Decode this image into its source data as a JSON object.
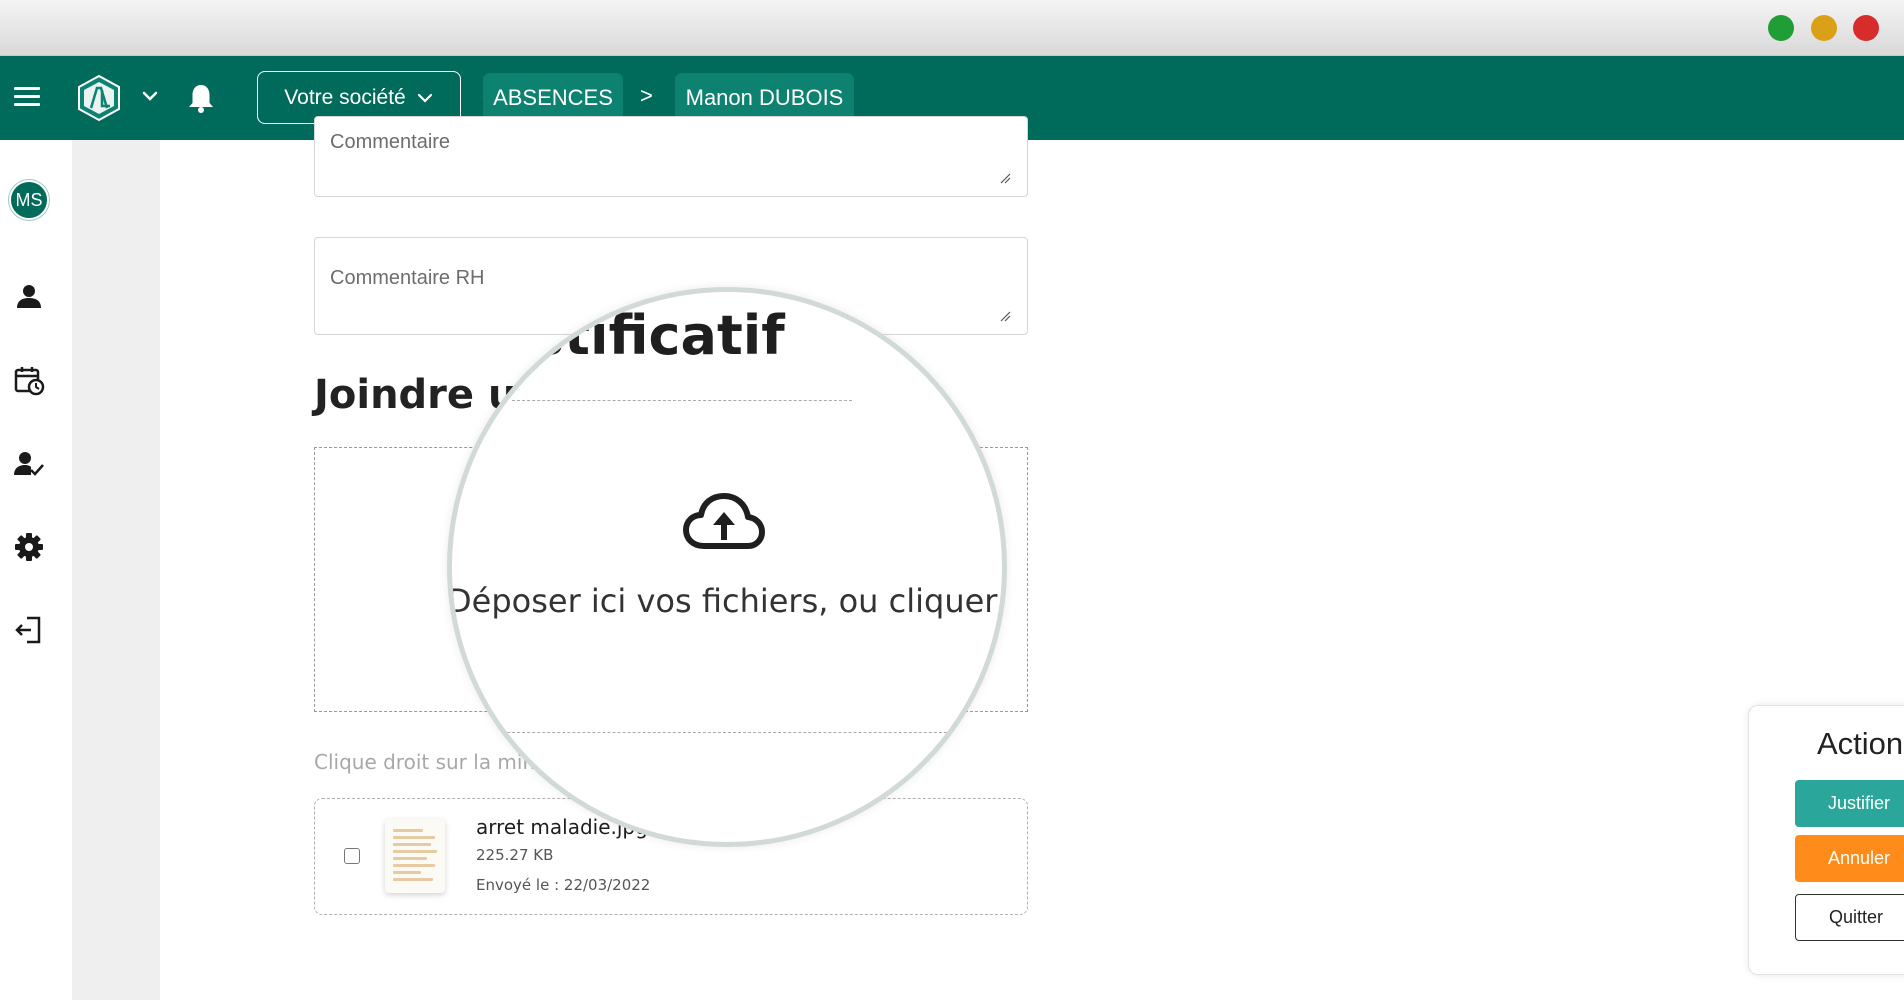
{
  "window": {
    "controls": [
      "maximize",
      "minimize",
      "close"
    ],
    "colors": {
      "maximize": "#1e9e34",
      "minimize": "#d9a018",
      "close": "#d72c2c"
    }
  },
  "navbar": {
    "background": "#006b5a",
    "menu_icon": "hamburger-icon",
    "logo_icon": "app-logo",
    "notifications_icon": "bell-icon",
    "company_selector": {
      "label": "Votre société"
    },
    "breadcrumb": {
      "items": [
        "ABSENCES",
        "Manon DUBOIS"
      ],
      "separator": ">"
    }
  },
  "sidebar": {
    "avatar_initials": "MS",
    "items": [
      {
        "icon": "user-icon"
      },
      {
        "icon": "calendar-clock-icon"
      },
      {
        "icon": "user-check-icon"
      },
      {
        "icon": "gear-icon"
      },
      {
        "icon": "logout-icon"
      }
    ]
  },
  "form": {
    "commentaire_label": "Commentaire",
    "commentaire_rh_label": "Commentaire RH",
    "section_title_visible": "Joindre ur",
    "dropzone_hint_visible": "Clique droit sur la mini",
    "file": {
      "name": "arret maladie.jpg",
      "size": "225.27 KB",
      "sent": "Envoyé le : 22/03/2022",
      "checked": false
    }
  },
  "magnifier": {
    "title_fragment": "stificatif",
    "dropzone_text": "Déposer ici vos fichiers, ou cliquer ici",
    "upload_icon": "cloud-upload-icon"
  },
  "actions": {
    "title": "Action",
    "justify_label": "Justifier",
    "cancel_label": "Annuler",
    "quit_label": "Quitter",
    "colors": {
      "justify": "#2aa79a",
      "cancel": "#ff8c1a"
    }
  }
}
